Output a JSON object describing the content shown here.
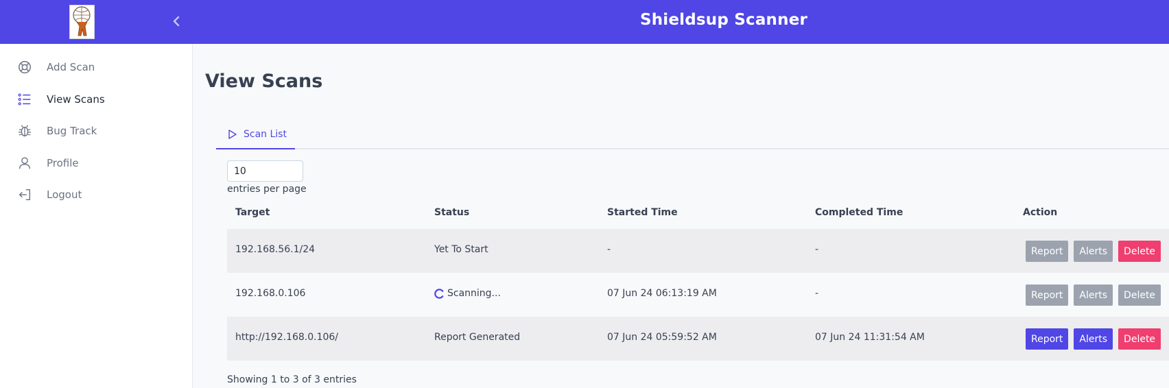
{
  "header": {
    "app_title": "Shieldsup Scanner",
    "logo_icon": "atlas-globe-logo",
    "collapse_icon": "chevron-left-icon"
  },
  "sidebar": {
    "items": [
      {
        "label": "Add Scan",
        "icon": "lifebuoy-icon",
        "active": false
      },
      {
        "label": "View Scans",
        "icon": "list-icon",
        "active": true
      },
      {
        "label": "Bug Track",
        "icon": "bug-icon",
        "active": false
      },
      {
        "label": "Profile",
        "icon": "user-icon",
        "active": false
      },
      {
        "label": "Logout",
        "icon": "logout-icon",
        "active": false
      }
    ]
  },
  "main": {
    "page_title": "View Scans",
    "tabs": [
      {
        "label": "Scan List",
        "icon": "play-icon",
        "active": true
      }
    ],
    "per_page": {
      "value": "10",
      "label": "entries per page"
    },
    "table": {
      "headers": [
        "Target",
        "Status",
        "Started Time",
        "Completed Time",
        "Action"
      ],
      "rows": [
        {
          "target": "192.168.56.1/24",
          "status": "Yet To Start",
          "started": "-",
          "completed": "-",
          "report": "Report",
          "alerts": "Alerts",
          "delete": "Delete"
        },
        {
          "target": "192.168.0.106",
          "status": "Scanning...",
          "started": "07 Jun 24 06:13:19 AM",
          "completed": "-",
          "report": "Report",
          "alerts": "Alerts",
          "delete": "Delete"
        },
        {
          "target": "http://192.168.0.106/",
          "status": "Report Generated",
          "started": "07 Jun 24 05:59:52 AM",
          "completed": "07 Jun 24 11:31:54 AM",
          "report": "Report",
          "alerts": "Alerts",
          "delete": "Delete"
        }
      ]
    },
    "footer_info": "Showing 1 to 3 of 3 entries"
  },
  "colors": {
    "primary": "#4f46e5",
    "danger": "#ef3e6f",
    "disabled": "#9ca3af",
    "row_stripe": "#ededf0"
  }
}
